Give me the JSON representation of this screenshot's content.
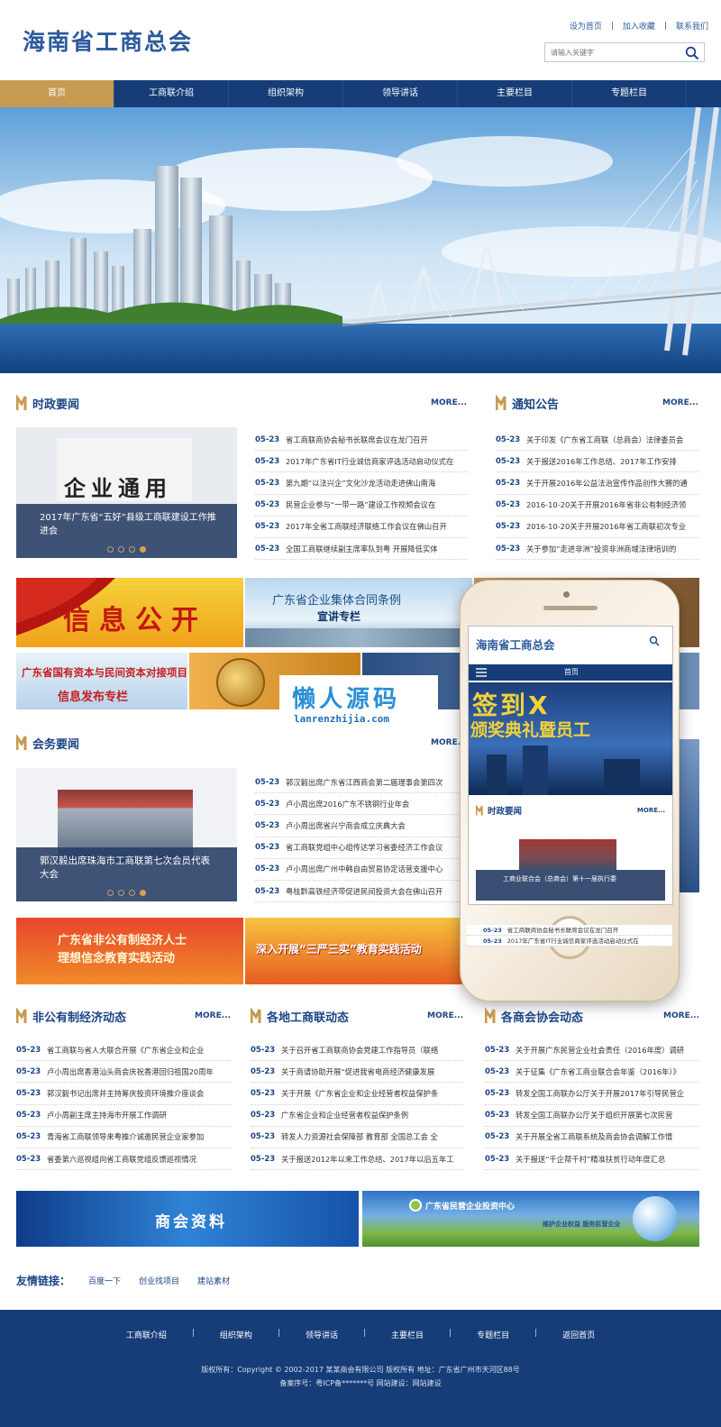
{
  "header": {
    "logo": "海南省工商总会",
    "top_links": [
      "设为首页",
      "加入收藏",
      "联系我们"
    ],
    "search_placeholder": "请输入关键字"
  },
  "nav": {
    "items": [
      "首页",
      "工商联介绍",
      "组织架构",
      "领导讲话",
      "主要栏目",
      "专题栏目"
    ],
    "active_index": 0
  },
  "sections": {
    "shizheng": {
      "title": "时政要闻",
      "more": "MORE...",
      "slide_caption": "2017年广东省“五好”县级工商联建设工作推进会",
      "slide_sign": "企业通用",
      "slide_active_dot": 3,
      "items": [
        {
          "date": "05-23",
          "text": "省工商联商协会秘书长联席会议在龙门召开"
        },
        {
          "date": "05-23",
          "text": "2017年广东省IT行业诚信商家评选活动启动仪式在"
        },
        {
          "date": "05-23",
          "text": "第九期“以法兴企”文化沙龙活动走进佛山南海"
        },
        {
          "date": "05-23",
          "text": "民营企业参与“一带一路”建设工作视频会议在"
        },
        {
          "date": "05-23",
          "text": "2017年全省工商联经济联络工作会议在佛山召开"
        },
        {
          "date": "05-23",
          "text": "全国工商联继续副主席率队到粤 开展降低实体"
        }
      ]
    },
    "tongzhi": {
      "title": "通知公告",
      "more": "MORE...",
      "items": [
        {
          "date": "05-23",
          "text": "关于印发《广东省工商联（总商会）法律委员会"
        },
        {
          "date": "05-23",
          "text": "关于报送2016年工作总结、2017年工作安排"
        },
        {
          "date": "05-23",
          "text": "关于开展2016年公益法治宣传作品创作大赛的通"
        },
        {
          "date": "05-23",
          "text": "2016-10-20关于开展2016年省非公有制经济领"
        },
        {
          "date": "05-23",
          "text": "2016-10-20关于开展2016年省工商联初次专业"
        },
        {
          "date": "05-23",
          "text": "关于参加“走进非洲”投资非洲商域法律培训的"
        }
      ]
    },
    "huiwu": {
      "title": "会务要闻",
      "more": "MORE...",
      "slide_caption": "郭汉毅出席珠海市工商联第七次会员代表大会",
      "slide_active_dot": 3,
      "items": [
        {
          "date": "05-23",
          "text": "郭汉毅出席广东省江西商会第二届理事会第四次"
        },
        {
          "date": "05-23",
          "text": "卢小周出席2016广东不锈钢行业年会"
        },
        {
          "date": "05-23",
          "text": "卢小周出席省兴宁商会成立庆典大会"
        },
        {
          "date": "05-23",
          "text": "省工商联党组中心组传达学习省委经济工作会议"
        },
        {
          "date": "05-23",
          "text": "卢小周出席广州中韩自由贸易协定话营支援中心"
        },
        {
          "date": "05-23",
          "text": "粤桂黔高铁经济带促进民间投资大会在佛山召开"
        }
      ]
    },
    "feigong": {
      "title": "非公有制经济动态",
      "more": "MORE...",
      "items": [
        {
          "date": "05-23",
          "text": "省工商联与省人大联合开展《广东省企业和企业"
        },
        {
          "date": "05-23",
          "text": "卢小周出席香港汕头商会庆祝香港回归祖国20周年"
        },
        {
          "date": "05-23",
          "text": "郭汉毅书记出席并主持筹庆投资环境推介座谈会"
        },
        {
          "date": "05-23",
          "text": "卢小周副主席主持海市开展工作调研"
        },
        {
          "date": "05-23",
          "text": "青海省工商联领导来粤推介诚邀民营企业家参加"
        },
        {
          "date": "05-23",
          "text": "省委第六巡视组向省工商联党组反馈巡视情况"
        }
      ]
    },
    "gedi": {
      "title": "各地工商联动态",
      "more": "MORE...",
      "items": [
        {
          "date": "05-23",
          "text": "关于召开省工商联商协会党建工作指导员（联络"
        },
        {
          "date": "05-23",
          "text": "关于商请协助开展“促进我省电商经济健康发展"
        },
        {
          "date": "05-23",
          "text": "关于开展《广东省企业和企业经营者权益保护条"
        },
        {
          "date": "05-23",
          "text": "广东省企业和企业经营者权益保护条例"
        },
        {
          "date": "05-23",
          "text": "转发人力资源社会保障部 教育部 全国总工会 全"
        },
        {
          "date": "05-23",
          "text": "关于报送2012年以来工作总结、2017年以后五年工"
        }
      ]
    },
    "shanghui": {
      "title": "各商会协会动态",
      "more": "MORE...",
      "items": [
        {
          "date": "05-23",
          "text": "关于开展广东民营企业社会责任（2016年度）调研"
        },
        {
          "date": "05-23",
          "text": "关于征集《广东省工商业联合会年鉴（2016年）》"
        },
        {
          "date": "05-23",
          "text": "转发全国工商联办公厅关于开展2017年引导民营企"
        },
        {
          "date": "05-23",
          "text": "转发全国工商联办公厅关于组织开展第七次民营"
        },
        {
          "date": "05-23",
          "text": "关于开展全省工商联系统及商会协会调解工作情"
        },
        {
          "date": "05-23",
          "text": "关于报送“千企帮千村”精准扶贫行动年度汇总"
        }
      ]
    }
  },
  "promos": {
    "xinxi": "信息公开",
    "jiti_line1": "广东省企业集体合同条例",
    "jiti_line2": "宣讲专栏",
    "ziben_line1": "广东省国有资本与民间资本对接项目",
    "ziben_line2": "信息发布专栏",
    "feigong_line1": "广东省非公有制经济人士",
    "feigong_line2": "理想信念教育实践活动",
    "sanyan": "深入开展“三严三实”教育实践活动",
    "ziliao": "商会资料",
    "touzi_title": "广东省民营企业投资中心",
    "touzi_sub": "维护企业权益 服务民营企业"
  },
  "phone": {
    "logo": "海南省工商总会",
    "nav_label": "首页",
    "banner_text_1": "签到X",
    "banner_text_2": "颁奖典礼暨员工",
    "section_title": "时政要闻",
    "section_more": "MORE...",
    "slide_caption": "工商业联合会（总商会）第十一届执行委",
    "items": [
      {
        "date": "05-23",
        "text": "省工商联商协会秘书长联席会议在龙门召开"
      },
      {
        "date": "05-23",
        "text": "2017年广东省IT行业诚信商家评选活动启动仪式在"
      }
    ]
  },
  "watermark": {
    "title": "懒人源码",
    "url": "lanrenzhijia.com"
  },
  "friends": {
    "label": "友情链接：",
    "links": [
      "百度一下",
      "创业找项目",
      "建站素材"
    ]
  },
  "footer": {
    "nav": [
      "工商联介绍",
      "组织架构",
      "领导讲话",
      "主要栏目",
      "专题栏目",
      "返回首页"
    ],
    "copyright": "版权所有：Copyright © 2002-2017 某某商会有限公司 版权所有  地址：广东省广州市天河区88号",
    "icp": "备案序号：粤ICP备*******号  网站建设：网站建设"
  },
  "colors": {
    "primary": "#163d78",
    "accent": "#c69a50",
    "link": "#1c4585"
  }
}
